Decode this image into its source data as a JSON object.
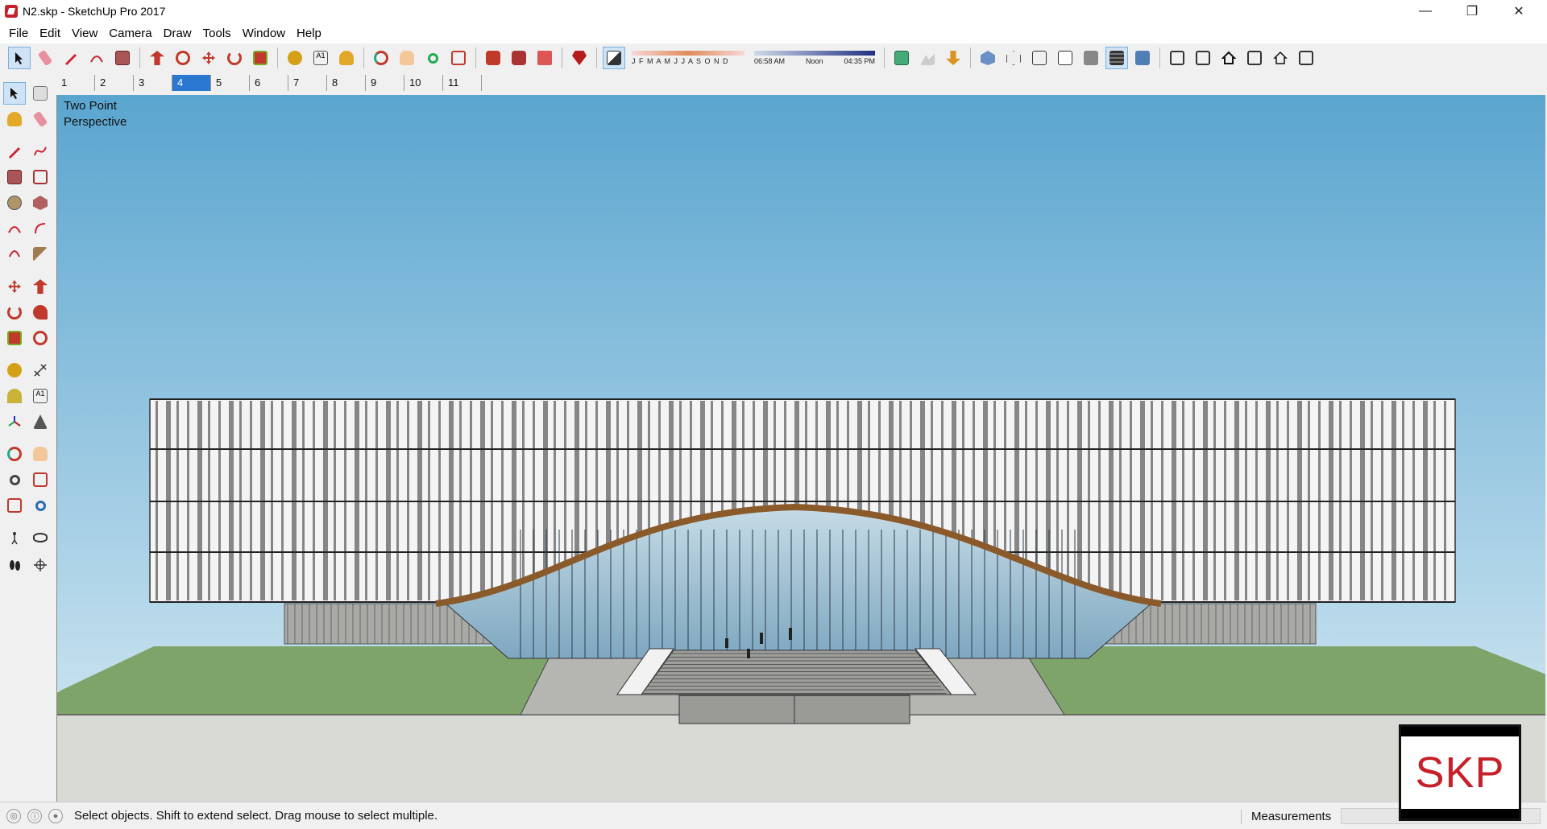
{
  "window": {
    "title": "N2.skp - SketchUp Pro 2017",
    "minimize": "—",
    "restore": "❐",
    "close": "✕"
  },
  "menu": [
    "File",
    "Edit",
    "View",
    "Camera",
    "Draw",
    "Tools",
    "Window",
    "Help"
  ],
  "toolbar": {
    "shadow": {
      "months": "J F M A M J J A S O N D",
      "time_start": "06:58 AM",
      "time_mid": "Noon",
      "time_end": "04:35 PM"
    }
  },
  "scenes": [
    "1",
    "2",
    "3",
    "4",
    "5",
    "6",
    "7",
    "8",
    "9",
    "10",
    "11"
  ],
  "selected_scene": "4",
  "viewport": {
    "camera_label_line1": "Two Point",
    "camera_label_line2": "Perspective",
    "sky_top": "#5aa5cf",
    "sky_bottom": "#c4e0ee",
    "grass": "#7fa46a",
    "ground": "#d9d9d5"
  },
  "status": {
    "message": "Select objects. Shift to extend select. Drag mouse to select multiple.",
    "measurements_label": "Measurements",
    "measurements_value": ""
  },
  "logo": {
    "text": "SKP",
    "color": "#c62029"
  }
}
